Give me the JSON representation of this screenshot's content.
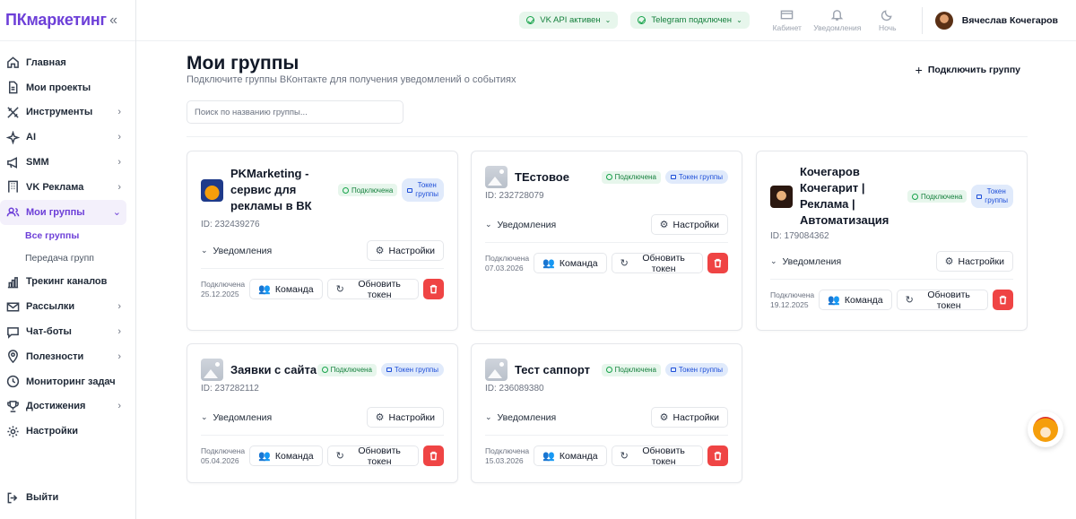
{
  "app": {
    "logo": "ПКмаркетинг",
    "collapse_icon": "double-chevron-left-icon"
  },
  "sidebar": {
    "items": [
      {
        "label": "Главная",
        "icon": "home-icon",
        "chevron": false
      },
      {
        "label": "Мои проекты",
        "icon": "file-icon",
        "chevron": false
      },
      {
        "label": "Инструменты",
        "icon": "tools-icon",
        "chevron": true
      },
      {
        "label": "AI",
        "icon": "sparkles-icon",
        "chevron": true
      },
      {
        "label": "SMM",
        "icon": "megaphone-icon",
        "chevron": true
      },
      {
        "label": "VK Реклама",
        "icon": "building-icon",
        "chevron": true
      },
      {
        "label": "Мои группы",
        "icon": "users-icon",
        "chevron": true,
        "active": true
      },
      {
        "label": "Трекинг каналов",
        "icon": "bar-chart-icon",
        "chevron": false
      },
      {
        "label": "Рассылки",
        "icon": "mail-icon",
        "chevron": true
      },
      {
        "label": "Чат-боты",
        "icon": "chat-icon",
        "chevron": true
      },
      {
        "label": "Полезности",
        "icon": "pin-icon",
        "chevron": true
      },
      {
        "label": "Мониторинг задач",
        "icon": "clock-icon",
        "chevron": false
      },
      {
        "label": "Достижения",
        "icon": "trophy-icon",
        "chevron": true
      },
      {
        "label": "Настройки",
        "icon": "gear-icon",
        "chevron": false
      }
    ],
    "sub_items": [
      {
        "label": "Все группы",
        "active": true
      },
      {
        "label": "Передача групп",
        "active": false
      }
    ],
    "logout": "Выйти"
  },
  "topbar": {
    "vk_status": "VK API активен",
    "tg_status": "Telegram подключен",
    "cabinet": "Кабинет",
    "notifications": "Уведомления",
    "night": "Ночь",
    "user_name": "Вячеслав Кочегаров"
  },
  "main": {
    "title": "Мои группы",
    "subtitle": "Подключите группы ВКонтакте для получения уведомлений о событиях",
    "add_button": "Подключить группу",
    "search_placeholder": "Поиск по названию группы..."
  },
  "labels": {
    "connected": "Подключена",
    "token": "Токен группы",
    "token_line1": "Токен",
    "token_line2": "группы",
    "notifications": "Уведомления",
    "settings": "Настройки",
    "team": "Команда",
    "refresh_token": "Обновить токен",
    "connected_on": "Подключена"
  },
  "groups": [
    {
      "name_lines": [
        "PKMarketing -",
        "сервис для",
        "рекламы в ВК"
      ],
      "id": "ID: 232439276",
      "date": "25.12.2025",
      "icon": "fox-logo"
    },
    {
      "name_lines": [
        "ТЕстовое"
      ],
      "id": "ID: 232728079",
      "date": "07.03.2026",
      "icon": "image-placeholder"
    },
    {
      "name_lines": [
        "Кочегаров",
        "Кочегарит |",
        "Реклама |",
        "Автоматизация"
      ],
      "id": "ID: 179084362",
      "date": "19.12.2025",
      "icon": "person-photo"
    },
    {
      "name_lines": [
        "Заявки с сайта"
      ],
      "id": "ID: 237282112",
      "date": "05.04.2026",
      "icon": "image-placeholder"
    },
    {
      "name_lines": [
        "Тест саппорт"
      ],
      "id": "ID: 236089380",
      "date": "15.03.2026",
      "icon": "image-placeholder"
    }
  ]
}
